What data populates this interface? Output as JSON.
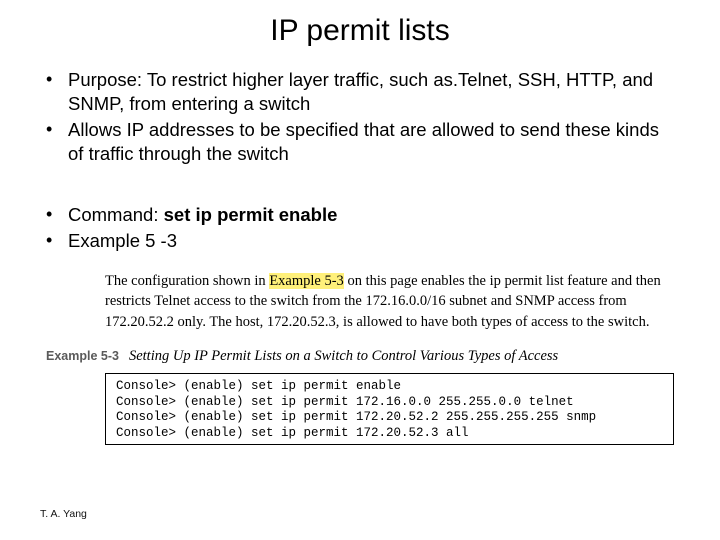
{
  "title": "IP permit lists",
  "bullets": {
    "b1": "Purpose: To restrict higher layer traffic, such as.Telnet, SSH, HTTP, and SNMP, from entering a switch",
    "b2": "Allows IP addresses to be specified that are allowed to send these kinds of traffic through the switch",
    "b3_prefix": "Command: ",
    "b3_bold": "set ip permit enable",
    "b4": "Example 5 -3"
  },
  "excerpt": {
    "pre": "The configuration shown in ",
    "hl": "Example 5-3",
    "post": " on this page enables the ip permit list feature and then restricts Telnet access to the switch from the 172.16.0.0/16 subnet and SNMP access from 172.20.52.2 only. The host, 172.20.52.3, is allowed to have both types of access to the switch."
  },
  "example": {
    "label": "Example 5-3",
    "caption": "Setting Up IP Permit Lists on a Switch to Control Various Types of Access"
  },
  "code": {
    "l1": "Console> (enable) set ip permit enable",
    "l2": "Console> (enable) set ip permit 172.16.0.0 255.255.0.0 telnet",
    "l3": "Console> (enable) set ip permit 172.20.52.2 255.255.255.255 snmp",
    "l4": "Console> (enable) set ip permit 172.20.52.3 all"
  },
  "footer": "T. A. Yang"
}
